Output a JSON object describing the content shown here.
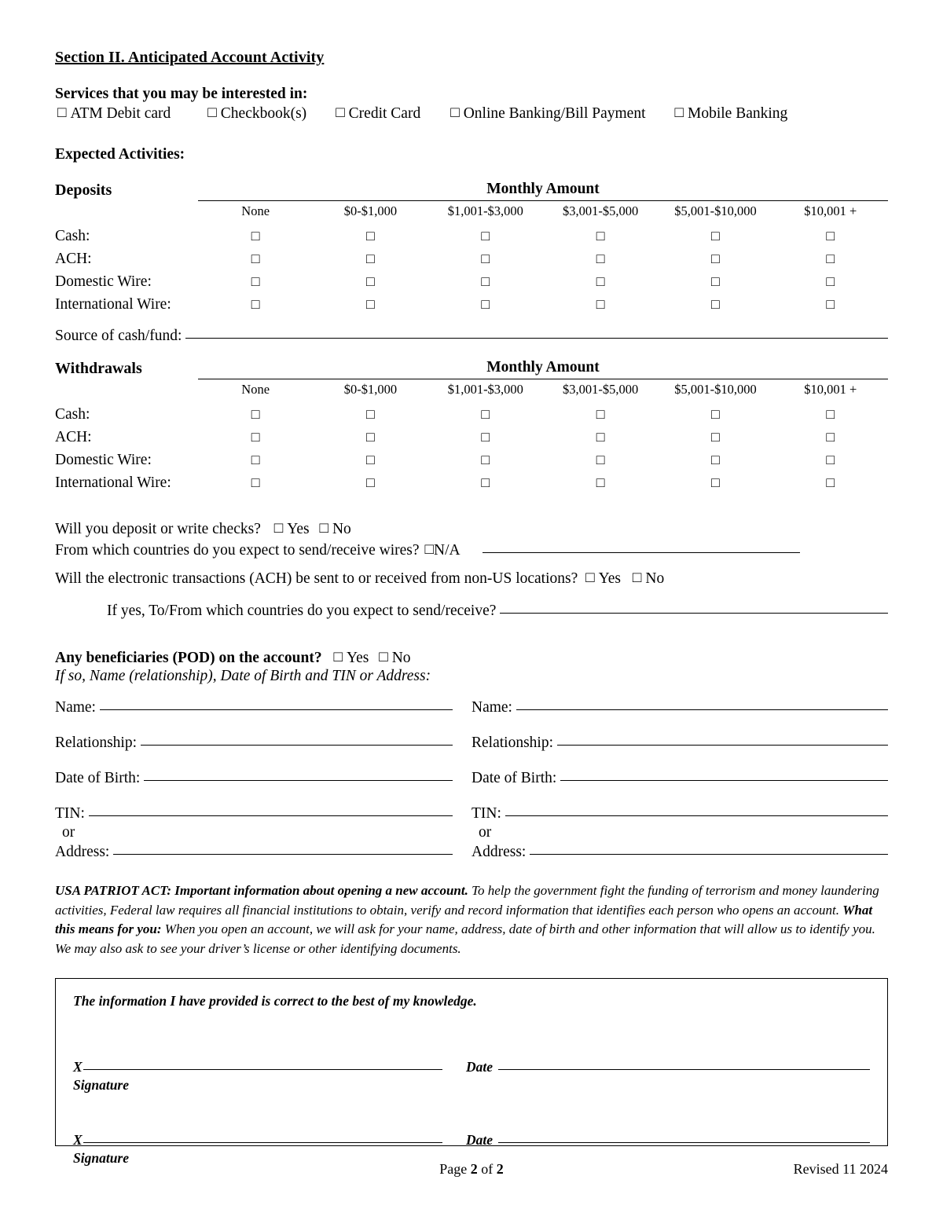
{
  "section": {
    "title": "Section II.  Anticipated Account Activity"
  },
  "services": {
    "heading": "Services that you may be interested in:",
    "options": [
      "ATM Debit card",
      "Checkbook(s)",
      "Credit Card",
      "Online Banking/Bill Payment",
      "Mobile Banking"
    ]
  },
  "expected_activities_heading": "Expected Activities:",
  "amount_columns": [
    "None",
    "$0-$1,000",
    "$1,001-$3,000",
    "$3,001-$5,000",
    "$5,001-$10,000",
    "$10,001 +"
  ],
  "activity_rows": [
    "Cash:",
    "ACH:",
    "Domestic Wire:",
    "International Wire:"
  ],
  "deposits": {
    "label": "Deposits",
    "monthly_amount": "Monthly Amount"
  },
  "withdrawals": {
    "label": "Withdrawals",
    "monthly_amount": "Monthly Amount"
  },
  "source_of_funds": {
    "label": "Source of cash/fund:"
  },
  "questions": {
    "checks": {
      "text": "Will you deposit or write checks?",
      "yes": "Yes",
      "no": "No"
    },
    "wire_countries": {
      "text": "From which countries do you expect to send/receive wires?",
      "na": "N/A"
    },
    "ach_non_us": {
      "text": "Will the electronic transactions (ACH) be sent to or received from non-US locations?",
      "yes": "Yes",
      "no": "No"
    },
    "ach_countries": {
      "text": "If yes, To/From which countries do you expect to send/receive?"
    }
  },
  "beneficiaries": {
    "heading": "Any beneficiaries (POD) on the account?",
    "yes": "Yes",
    "no": "No",
    "subheading": "If so, Name (relationship), Date of Birth and TIN or Address:",
    "fields": {
      "name": "Name:",
      "relationship": "Relationship:",
      "date_of_birth": "Date of Birth:",
      "tin": "TIN:",
      "or": "or",
      "address": "Address:"
    }
  },
  "patriot_act": {
    "lead_bold": "USA PATRIOT ACT: Important information about opening a new account.",
    "body_1": " To help the government fight the funding of terrorism and money laundering activities, Federal law requires all financial institutions to obtain, verify and record information that identifies each person who opens an account.  ",
    "mid_bold": "What this means for you:",
    "body_2": " When you open an account, we will ask for your name, address, date of birth and other information that will allow us to identify you.  We may also ask to see your driver’s license or other identifying documents."
  },
  "signature_box": {
    "statement": "The information I have provided is correct to the best of my knowledge.",
    "x_label": "X",
    "date_label": "Date",
    "signature_caption": "Signature"
  },
  "footer": {
    "page_prefix": "Page ",
    "page_number": "2",
    "page_mid": " of ",
    "page_total": "2",
    "revised": "Revised 11 2024"
  }
}
